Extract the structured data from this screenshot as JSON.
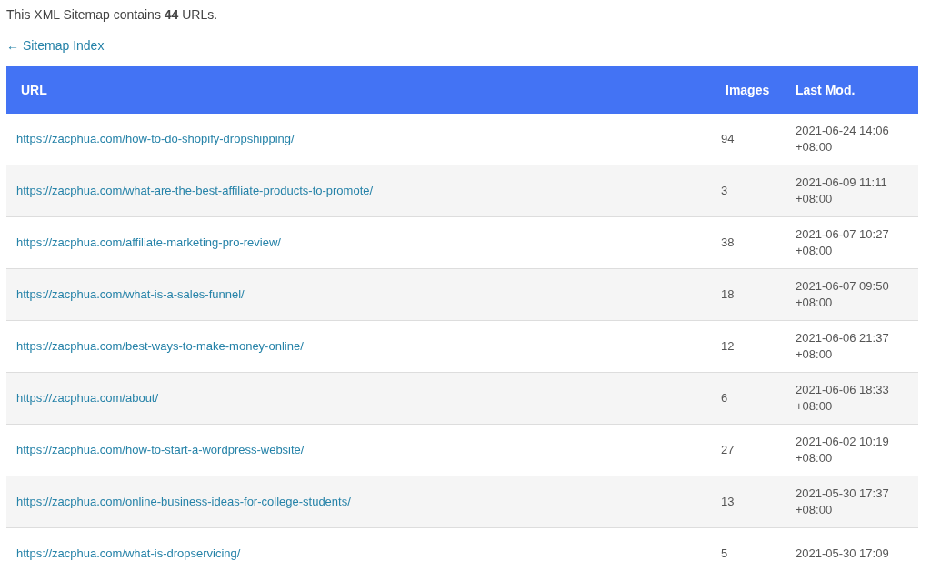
{
  "summary": "This XML Sitemap contains **44** URLs.",
  "back_link": "← Sitemap Index",
  "table": {
    "columns": [
      "URL",
      "Images",
      "Last Mod."
    ],
    "rows": [
      {
        "url": "https://zacphua.com/how-to-do-shopify-dropshipping/",
        "images": "94",
        "last_mod": [
          "2021-06-24 14:06",
          "+08:00"
        ]
      },
      {
        "url": "https://zacphua.com/what-are-the-best-affiliate-products-to-promote/",
        "images": "3",
        "last_mod": [
          "2021-06-09 11:11",
          "+08:00"
        ]
      },
      {
        "url": "https://zacphua.com/affiliate-marketing-pro-review/",
        "images": "38",
        "last_mod": [
          "2021-06-07 10:27",
          "+08:00"
        ]
      },
      {
        "url": "https://zacphua.com/what-is-a-sales-funnel/",
        "images": "18",
        "last_mod": [
          "2021-06-07 09:50",
          "+08:00"
        ]
      },
      {
        "url": "https://zacphua.com/best-ways-to-make-money-online/",
        "images": "12",
        "last_mod": [
          "2021-06-06 21:37",
          "+08:00"
        ]
      },
      {
        "url": "https://zacphua.com/about/",
        "images": "6",
        "last_mod": [
          "2021-06-06 18:33",
          "+08:00"
        ]
      },
      {
        "url": "https://zacphua.com/how-to-start-a-wordpress-website/",
        "images": "27",
        "last_mod": [
          "2021-06-02 10:19",
          "+08:00"
        ]
      },
      {
        "url": "https://zacphua.com/online-business-ideas-for-college-students/",
        "images": "13",
        "last_mod": [
          "2021-05-30 17:37",
          "+08:00"
        ]
      },
      {
        "url": "https://zacphua.com/what-is-dropservicing/",
        "images": "5",
        "last_mod": [
          "2021-05-30 17:09"
        ]
      }
    ]
  }
}
